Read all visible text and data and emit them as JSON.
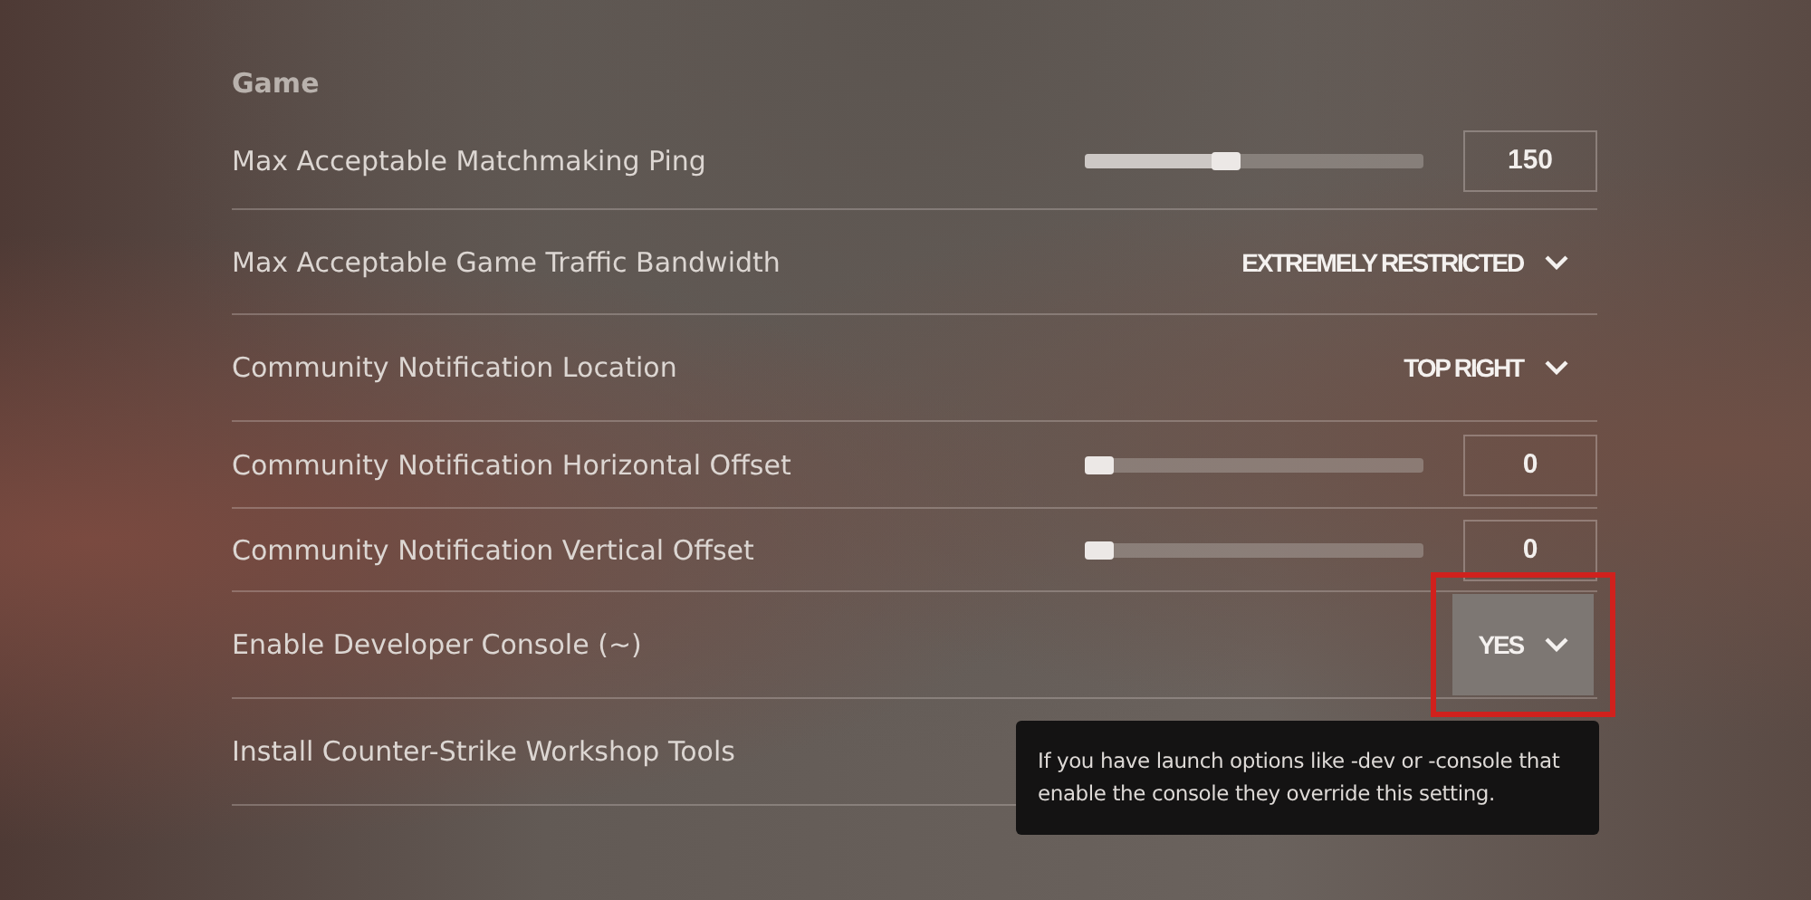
{
  "section": {
    "title": "Game"
  },
  "rows": [
    {
      "label": "Max Acceptable Matchmaking Ping",
      "kind": "slider",
      "level": 0.41,
      "value": "150",
      "highlighted": false
    },
    {
      "label": "Max Acceptable Game Traffic Bandwidth",
      "kind": "dropdown",
      "value": "EXTREMELY RESTRICTED",
      "highlighted": false
    },
    {
      "label": "Community Notification Location",
      "kind": "dropdown",
      "value": "TOP RIGHT",
      "highlighted": false
    },
    {
      "label": "Community Notification Horizontal Offset",
      "kind": "slider",
      "level": 0.0,
      "value": "0",
      "highlighted": false
    },
    {
      "label": "Community Notification Vertical Offset",
      "kind": "slider",
      "level": 0.0,
      "value": "0",
      "highlighted": false
    },
    {
      "label": "Enable Developer Console (~)",
      "kind": "dropdown",
      "value": "YES",
      "highlighted": true
    },
    {
      "label": "Install Counter-Strike Workshop Tools",
      "kind": "covered",
      "highlighted": false
    }
  ],
  "tooltip": {
    "text": "If you have launch options like -dev or -console that enable the console they override this setting."
  }
}
